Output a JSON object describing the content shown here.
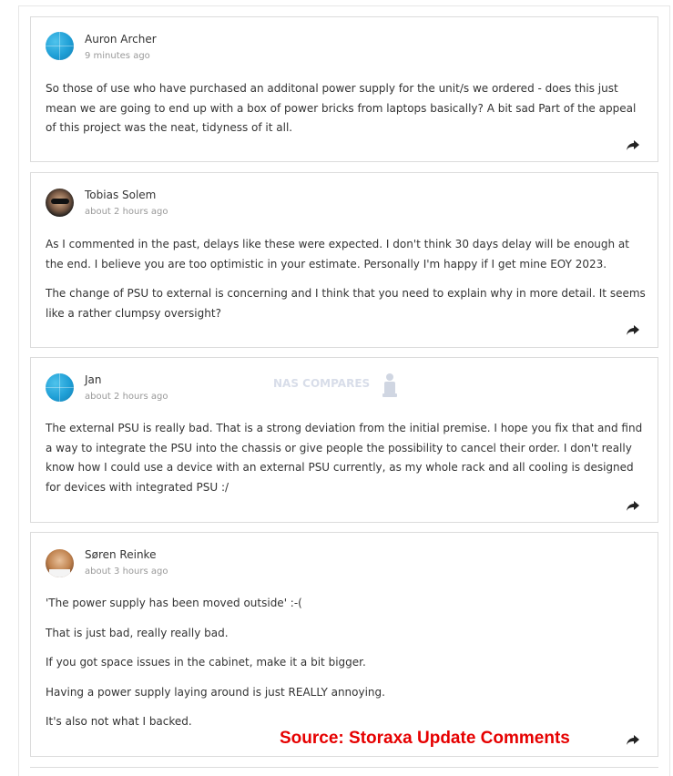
{
  "comments": [
    {
      "author": "Auron Archer",
      "time": "9 minutes ago",
      "paragraphs": [
        "So those of use who have purchased an additonal power supply for the unit/s we ordered - does this just mean we are going to end up with a box of power bricks from laptops basically? A bit sad Part of the appeal of this project was the neat, tidyness of it all."
      ]
    },
    {
      "author": "Tobias Solem",
      "time": "about 2 hours ago",
      "paragraphs": [
        "As I commented in the past, delays like these were expected. I don't think 30 days delay will be enough at the end. I believe you are too optimistic in your estimate. Personally I'm happy if I get mine EOY 2023.",
        "The change of PSU to external is concerning and I think that you need to explain why in more detail. It seems like a rather clumpsy oversight?"
      ]
    },
    {
      "author": "Jan",
      "time": "about 2 hours ago",
      "paragraphs": [
        "The external PSU is really bad. That is a strong deviation from the initial premise. I hope you fix that and find a way to integrate the PSU into the chassis or give people the possibility to cancel their order. I don't really know how I could use a device with an external PSU currently, as my whole rack and all cooling is designed for devices with integrated PSU :/"
      ]
    },
    {
      "author": "Søren Reinke",
      "time": "about 3 hours ago",
      "paragraphs": [
        "'The power supply has been moved outside' :-(",
        "That is just bad, really really bad.",
        "If you got space issues in the cabinet, make it a bit bigger.",
        "Having a power supply laying around is just REALLY annoying.",
        "It's also not what I backed."
      ]
    }
  ],
  "watermark": "NAS COMPARES",
  "source_caption": "Source: Storaxa Update Comments",
  "icons": {
    "share": "share-arrow-icon",
    "avatar_default": "globe-avatar-icon"
  },
  "colors": {
    "source_red": "#e60000",
    "card_border": "#dcdcdc",
    "avatar_blue": "#1f9fd6"
  }
}
